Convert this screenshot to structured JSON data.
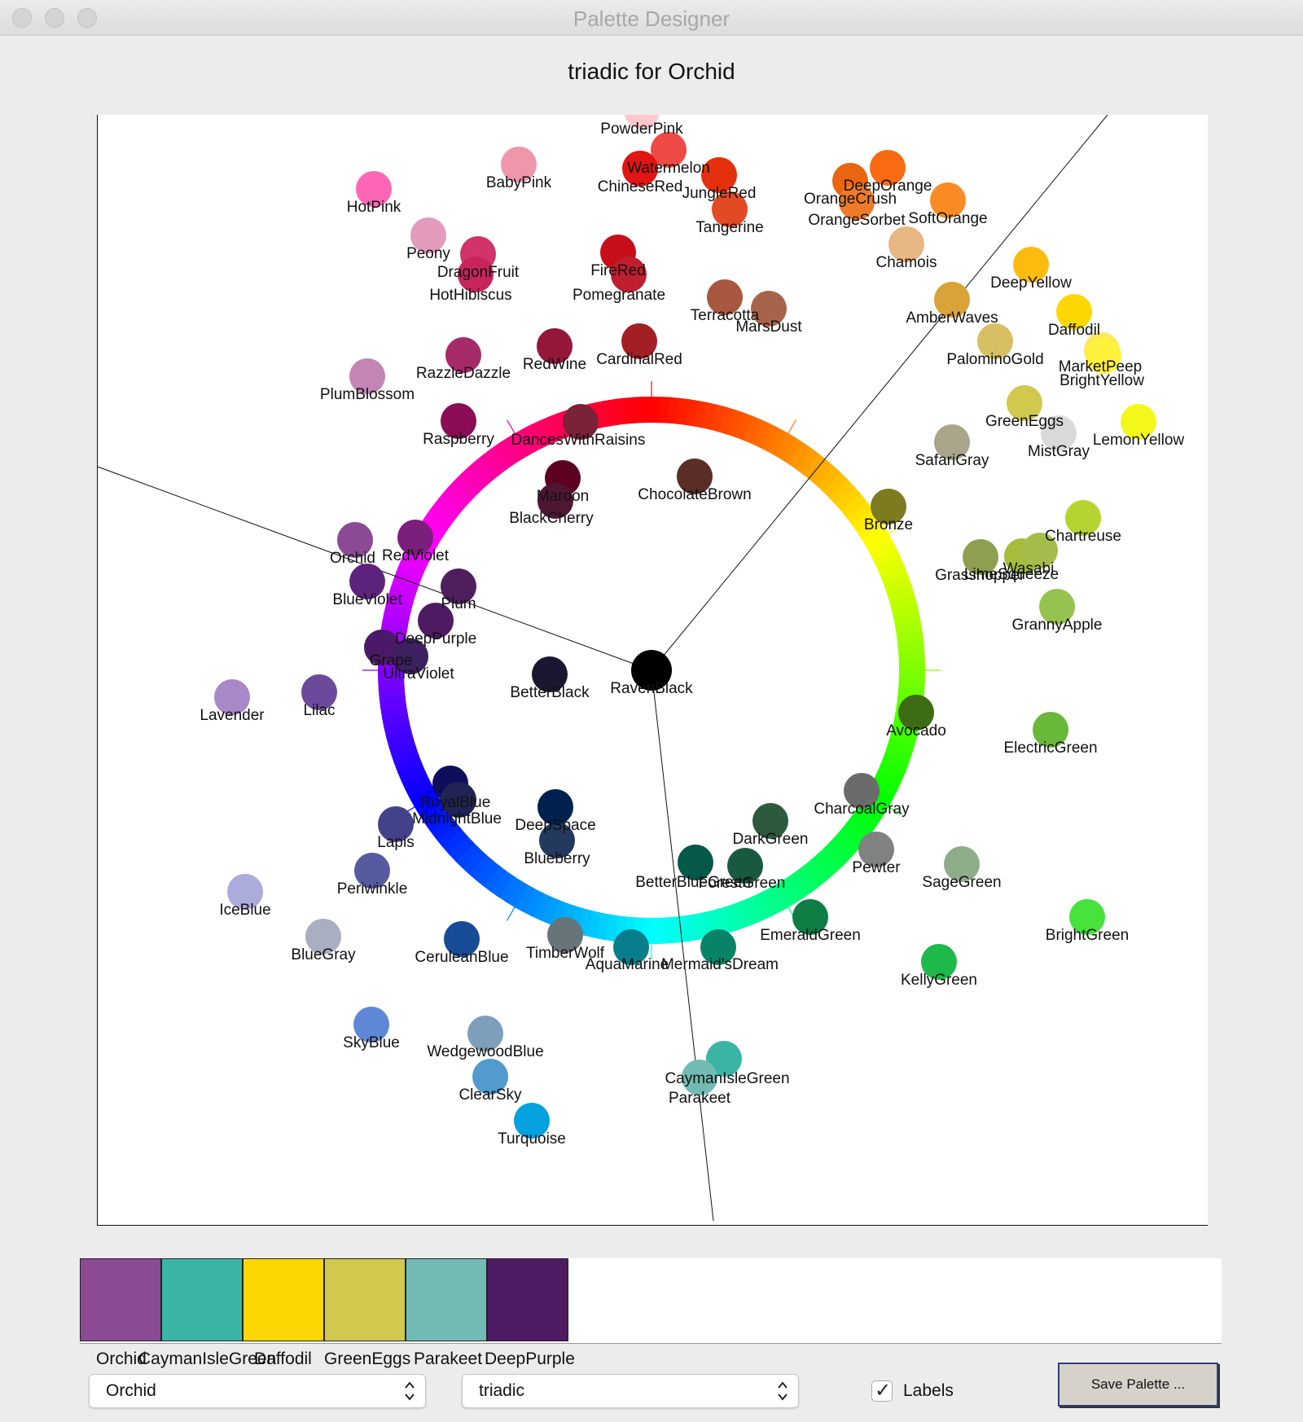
{
  "window": {
    "title": "Palette Designer"
  },
  "chart_title": "triadic for Orchid",
  "chart_data": {
    "type": "scatter",
    "title": "triadic for Orchid",
    "center": {
      "name": "RavenBlack",
      "color": "#000000"
    },
    "harmony_lines": [
      {
        "start": "RavenBlack",
        "end": "upper-left"
      },
      {
        "start": "RavenBlack",
        "end": "upper-right"
      },
      {
        "start": "RavenBlack",
        "end": "bottom"
      }
    ],
    "points": [
      {
        "name": "PowderPink",
        "color": "#FFC7CC"
      },
      {
        "name": "Watermelon",
        "color": "#EF4A46"
      },
      {
        "name": "ChineseRed",
        "color": "#E31414"
      },
      {
        "name": "JungleRed",
        "color": "#E5300E"
      },
      {
        "name": "Tangerine",
        "color": "#E24A25"
      },
      {
        "name": "BabyPink",
        "color": "#F096AB"
      },
      {
        "name": "HotPink",
        "color": "#FF67B6"
      },
      {
        "name": "Peony",
        "color": "#E29BBD"
      },
      {
        "name": "DragonFruit",
        "color": "#D0346A"
      },
      {
        "name": "HotHibiscus",
        "color": "#C8245E"
      },
      {
        "name": "FireRed",
        "color": "#C60F18"
      },
      {
        "name": "Pomegranate",
        "color": "#BF1E2E"
      },
      {
        "name": "Terracotta",
        "color": "#A8583F"
      },
      {
        "name": "MarsDust",
        "color": "#A8644A"
      },
      {
        "name": "CardinalRed",
        "color": "#A21F24"
      },
      {
        "name": "RedWine",
        "color": "#951739"
      },
      {
        "name": "RazzleDazzle",
        "color": "#A52A68"
      },
      {
        "name": "PlumBlossom",
        "color": "#C386B4"
      },
      {
        "name": "Raspberry",
        "color": "#8A0D55"
      },
      {
        "name": "DancesWithRaisins",
        "color": "#7A2237"
      },
      {
        "name": "Maroon",
        "color": "#5C0021"
      },
      {
        "name": "BlackCherry",
        "color": "#4F1734"
      },
      {
        "name": "ChocolateBrown",
        "color": "#5A2E26"
      },
      {
        "name": "DeepOrange",
        "color": "#F86B13"
      },
      {
        "name": "OrangeCrush",
        "color": "#E9650F"
      },
      {
        "name": "OrangeSorbet",
        "color": "#EF7A28"
      },
      {
        "name": "SoftOrange",
        "color": "#F88C22"
      },
      {
        "name": "Chamois",
        "color": "#E7B784"
      },
      {
        "name": "DeepYellow",
        "color": "#FDBB0F"
      },
      {
        "name": "AmberWaves",
        "color": "#D9A33A"
      },
      {
        "name": "Daffodil",
        "color": "#FCD704"
      },
      {
        "name": "PalominoGold",
        "color": "#D8BF63"
      },
      {
        "name": "MarketPeep",
        "color": "#FFE85A"
      },
      {
        "name": "BrightYellow",
        "color": "#FFF13C"
      },
      {
        "name": "GreenEggs",
        "color": "#D1C84E"
      },
      {
        "name": "MistGray",
        "color": "#D9D9D9"
      },
      {
        "name": "LemonYellow",
        "color": "#F4F81A"
      },
      {
        "name": "SafariGray",
        "color": "#A8A58A"
      },
      {
        "name": "Bronze",
        "color": "#7D7A20"
      },
      {
        "name": "Chartreuse",
        "color": "#B6D42F"
      },
      {
        "name": "Grasshopper",
        "color": "#8E9F4F"
      },
      {
        "name": "LimeSqueeze",
        "color": "#A6BD3B"
      },
      {
        "name": "Wasabi",
        "color": "#A4BD4A"
      },
      {
        "name": "GrannyApple",
        "color": "#96C34F"
      },
      {
        "name": "Avocado",
        "color": "#3E6C14"
      },
      {
        "name": "ElectricGreen",
        "color": "#6AB839"
      },
      {
        "name": "CharcoalGray",
        "color": "#6B6B6B"
      },
      {
        "name": "DarkGreen",
        "color": "#2D5A3D"
      },
      {
        "name": "BetterBlueGreen",
        "color": "#05594A"
      },
      {
        "name": "ForestGreen",
        "color": "#195A3E"
      },
      {
        "name": "Pewter",
        "color": "#7F8280"
      },
      {
        "name": "SageGreen",
        "color": "#8FAC8A"
      },
      {
        "name": "BrightGreen",
        "color": "#47E23C"
      },
      {
        "name": "EmeraldGreen",
        "color": "#0E7E44"
      },
      {
        "name": "KellyGreen",
        "color": "#1DB94A"
      },
      {
        "name": "Mermaid'sDream",
        "color": "#098368"
      },
      {
        "name": "AquaMarine",
        "color": "#087E8C"
      },
      {
        "name": "TimberWolf",
        "color": "#67757B"
      },
      {
        "name": "CeruleanBlue",
        "color": "#164C97"
      },
      {
        "name": "Blueberry",
        "color": "#23395D"
      },
      {
        "name": "DeepSpace",
        "color": "#01224E"
      },
      {
        "name": "RoyalBlue",
        "color": "#0E0F5C"
      },
      {
        "name": "MidnightBlue",
        "color": "#212354"
      },
      {
        "name": "Lapis",
        "color": "#42428A"
      },
      {
        "name": "Periwinkle",
        "color": "#565B9F"
      },
      {
        "name": "IceBlue",
        "color": "#ABABDC"
      },
      {
        "name": "BlueGray",
        "color": "#A9AEC0"
      },
      {
        "name": "SkyBlue",
        "color": "#5E88D6"
      },
      {
        "name": "WedgewoodBlue",
        "color": "#7E9FBC"
      },
      {
        "name": "ClearSky",
        "color": "#529BCE"
      },
      {
        "name": "Turquoise",
        "color": "#03A1DE"
      },
      {
        "name": "CaymanIsleGreen",
        "color": "#3AB5A3"
      },
      {
        "name": "Parakeet",
        "color": "#72BBB4"
      },
      {
        "name": "Lavender",
        "color": "#A689C6"
      },
      {
        "name": "Lilac",
        "color": "#6B4A9C"
      },
      {
        "name": "Orchid",
        "color": "#8B4A94"
      },
      {
        "name": "RedViolet",
        "color": "#7B1F7C"
      },
      {
        "name": "BlueViolet",
        "color": "#5E237C"
      },
      {
        "name": "Plum",
        "color": "#4F1E5F"
      },
      {
        "name": "DeepPurple",
        "color": "#4E1B63"
      },
      {
        "name": "Grape",
        "color": "#4A1A68"
      },
      {
        "name": "UltraViolet",
        "color": "#3D2060"
      },
      {
        "name": "BetterBlack",
        "color": "#1D1630"
      },
      {
        "name": "RavenBlack",
        "color": "#000000"
      }
    ]
  },
  "palette": [
    {
      "name": "Orchid",
      "color": "#8B4A94"
    },
    {
      "name": "CaymanIsleGreen",
      "color": "#3AB5A3"
    },
    {
      "name": "Daffodil",
      "color": "#FCD704"
    },
    {
      "name": "GreenEggs",
      "color": "#D1C84E"
    },
    {
      "name": "Parakeet",
      "color": "#72BBB4"
    },
    {
      "name": "DeepPurple",
      "color": "#4E1B63"
    }
  ],
  "controls": {
    "base_color_select": {
      "value": "Orchid"
    },
    "scheme_select": {
      "value": "triadic"
    },
    "labels_checkbox": {
      "label": "Labels",
      "checked": true
    },
    "save_button": {
      "label": "Save Palette ..."
    }
  }
}
